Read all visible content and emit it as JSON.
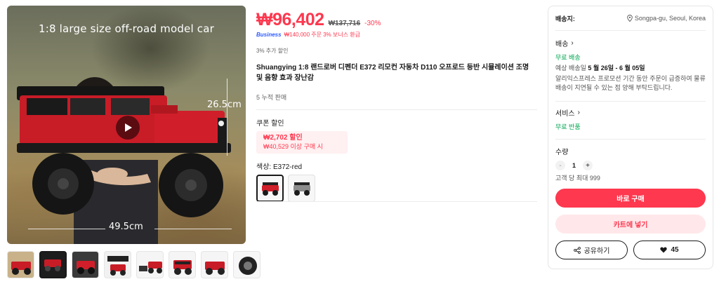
{
  "gallery": {
    "overlay_title": "1:8 large size off-road model car",
    "height_label": "26.5cm",
    "width_label": "49.5cm",
    "thumbnail_count": 8
  },
  "price": {
    "current": "₩96,402",
    "original": "₩137,716",
    "discount": "-30%",
    "business_tag": "Business",
    "business_text": "₩140,000 주문 3% 보너스 환급",
    "extra_discount": "3% 추가 할인"
  },
  "product": {
    "title": "Shuangying 1:8 랜드로버 디펜더 E372 리모컨 자동차 D110 오프로드 등반 시뮬레이션 조명 및 음향 효과 장난감",
    "sold": "5 누적 판매"
  },
  "coupon": {
    "label": "쿠폰 할인",
    "amount": "₩2,702 할인",
    "condition": "₩40,529 이상 구매 시"
  },
  "color": {
    "label": "색상: E372-red",
    "options": [
      "red",
      "gray"
    ]
  },
  "panel": {
    "ship_to_label": "배송지:",
    "ship_to_value": "Songpa-gu, Seoul, Korea",
    "shipping_head": "배송",
    "free_shipping": "무료 배송",
    "expected_prefix": "예상 배송일 ",
    "expected_dates": "5 월 26일 - 6 월 05일",
    "shipping_note": "알리익스프레스 프로모션 기간 동안 주문이 급증하여 물류 배송이 지연될 수 있는 점 양해 부탁드립니다.",
    "service_head": "서비스",
    "free_return": "무료 반품",
    "qty_label": "수량",
    "qty_minus": "-",
    "qty_value": "1",
    "qty_plus": "+",
    "qty_limit": "고객 당 최대 999",
    "buy_now": "바로 구매",
    "add_cart": "카트에 넣기",
    "share": "공유하기",
    "wishlist_count": "45"
  },
  "colors": {
    "accent": "#fd384f",
    "green": "#00a650",
    "business": "#2e5bff",
    "car_red": "#d01f2a"
  }
}
